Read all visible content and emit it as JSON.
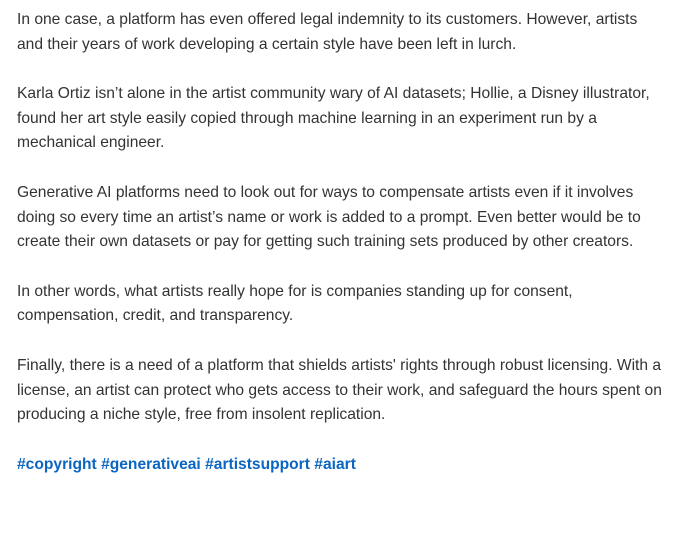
{
  "post": {
    "paragraphs": [
      "In one case, a platform has even offered legal indemnity to its customers. However, artists and their years of work developing a certain style have been left in lurch.",
      "Karla Ortiz isn’t alone in the artist community wary of AI datasets; Hollie, a Disney illustrator, found her art style easily copied through machine learning in an experiment run by a mechanical engineer.",
      "Generative AI platforms need to look out for ways to compensate artists even if it involves doing so every time an artist’s name or work is added to a prompt. Even better would be to create their own datasets or pay for getting such training sets produced by other creators.",
      "In other words, what artists really hope for is companies standing up for consent, compensation, credit, and transparency.",
      "Finally, there is a need of a platform that shields artists' rights through robust licensing. With a license, an artist can protect who gets access to their work, and safeguard the hours spent on producing a niche style, free from insolent replication."
    ],
    "hashtags": [
      "#copyright",
      "#generativeai",
      "#artistsupport",
      "#aiart"
    ]
  },
  "colors": {
    "text": "#333333",
    "hashtag": "#0a66c2",
    "background": "#ffffff"
  }
}
